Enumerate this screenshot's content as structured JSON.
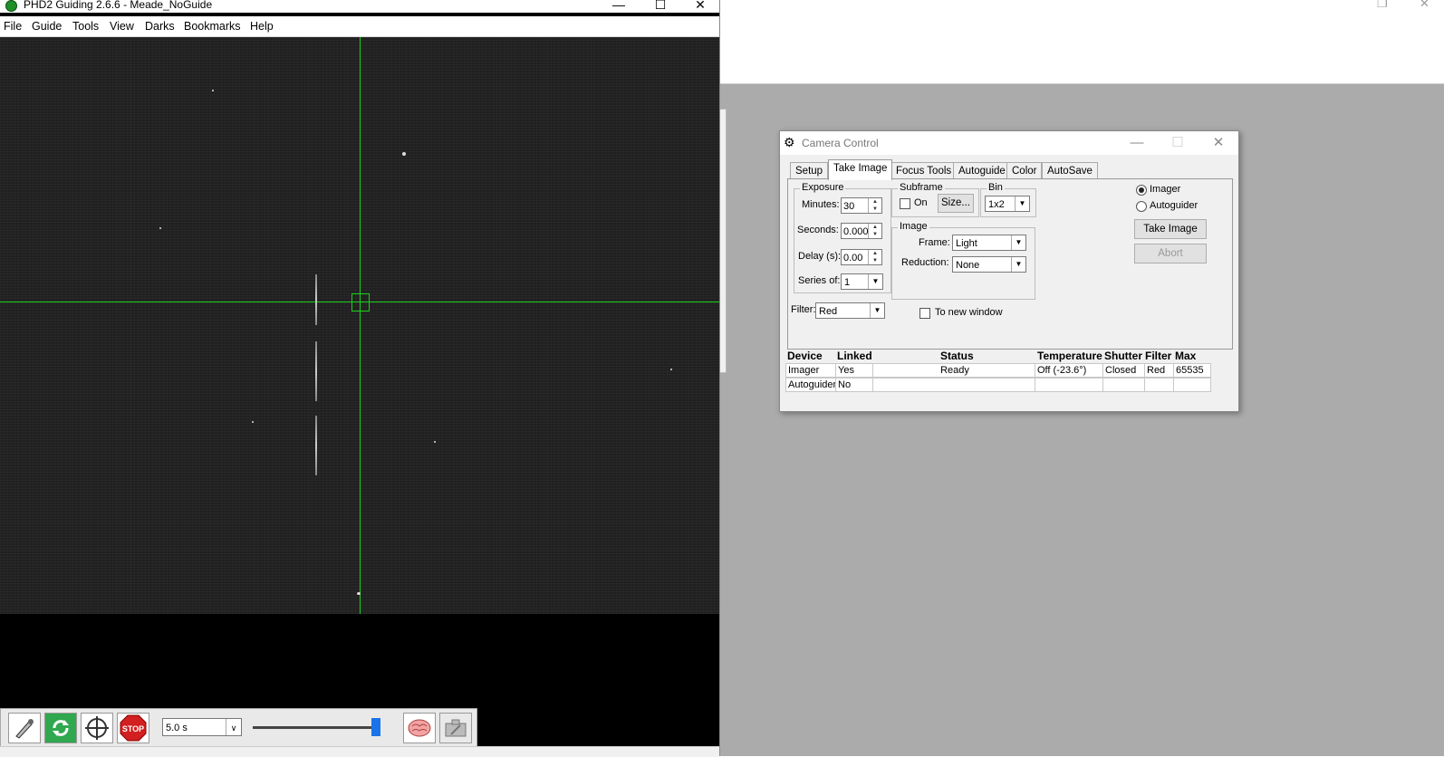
{
  "phd2": {
    "title": "PHD2 Guiding 2.6.6 - Meade_NoGuide",
    "menu": [
      "File",
      "Guide",
      "Tools",
      "View",
      "Darks",
      "Bookmarks",
      "Help"
    ],
    "exposure_value": "5.0 s",
    "toolbar_icons": [
      "use-connect-icon",
      "loop-icon",
      "auto-select-star-icon",
      "stop-icon",
      "brain-icon",
      "camera-settings-icon"
    ],
    "stop_label": "STOP"
  },
  "camera_control": {
    "title": "Camera Control",
    "tabs": [
      "Setup",
      "Take Image",
      "Focus Tools",
      "Autoguide",
      "Color",
      "AutoSave"
    ],
    "active_tab": "Take Image",
    "exposure_group": "Exposure",
    "minutes_label": "Minutes:",
    "minutes_value": "30",
    "seconds_label": "Seconds:",
    "seconds_value": "0.000",
    "delay_label": "Delay (s):",
    "delay_value": "0.00",
    "series_label": "Series of:",
    "series_value": "1",
    "subframe_group": "Subframe",
    "subframe_on_label": "On",
    "size_button": "Size...",
    "bin_group": "Bin",
    "bin_value": "1x2",
    "image_group": "Image",
    "frame_label": "Frame:",
    "frame_value": "Light",
    "reduction_label": "Reduction:",
    "reduction_value": "None",
    "filter_label": "Filter:",
    "filter_value": "Red",
    "new_window_label": "To new window",
    "radio_imager": "Imager",
    "radio_autoguider": "Autoguider",
    "take_image_button": "Take Image",
    "abort_button": "Abort",
    "device_table": {
      "headers": [
        "Device",
        "Linked",
        "Status",
        "Temperature",
        "Shutter",
        "Filter",
        "Max"
      ],
      "rows": [
        [
          "Imager",
          "Yes",
          "Ready",
          "Off (-23.6°)",
          "Closed",
          "Red",
          "65535"
        ],
        [
          "Autoguider",
          "No",
          "",
          "",
          "",
          "",
          ""
        ]
      ]
    }
  }
}
